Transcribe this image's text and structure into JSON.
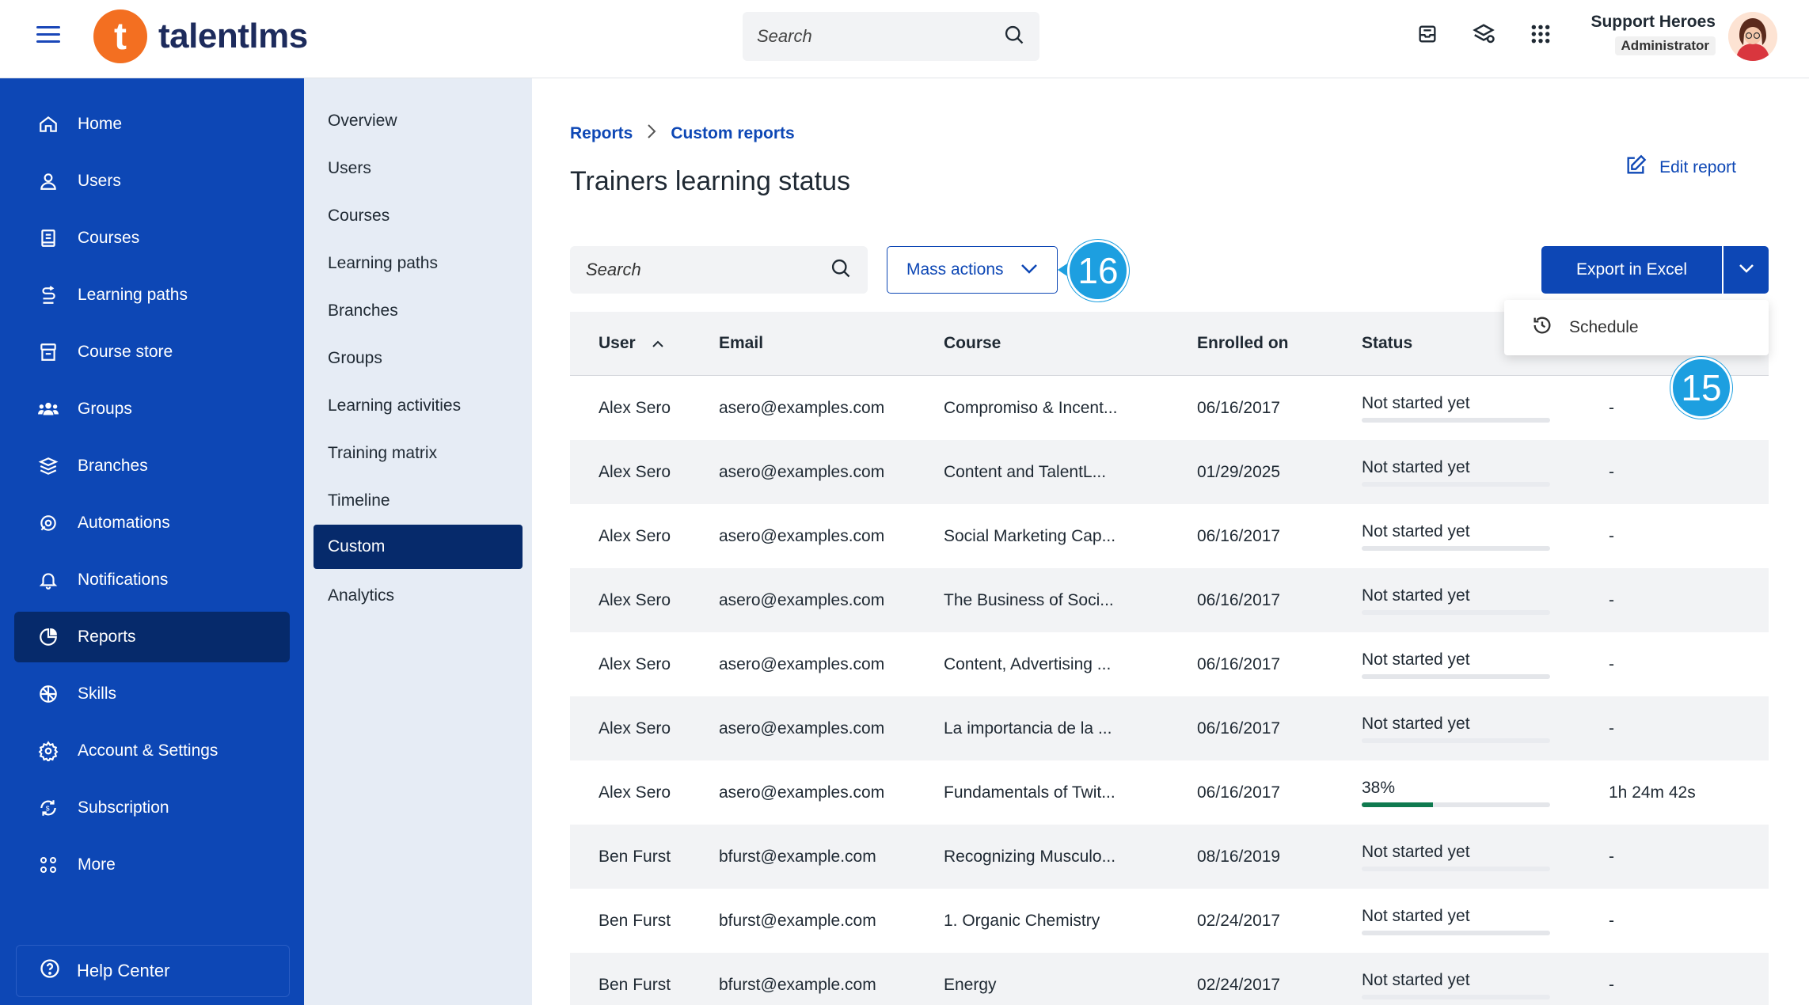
{
  "app": {
    "name": "talentlms",
    "logo_letter": "t",
    "brand_color": "#f36f21",
    "primary_color": "#0d47b5"
  },
  "topbar": {
    "search_placeholder": "Search",
    "icons": [
      "inbox-icon",
      "layers-sync-icon",
      "apps-grid-icon"
    ],
    "user_name": "Support Heroes",
    "user_role": "Administrator"
  },
  "sidebar": {
    "items": [
      {
        "label": "Home",
        "icon": "home-icon"
      },
      {
        "label": "Users",
        "icon": "user-icon"
      },
      {
        "label": "Courses",
        "icon": "course-icon"
      },
      {
        "label": "Learning paths",
        "icon": "path-icon"
      },
      {
        "label": "Course store",
        "icon": "store-icon"
      },
      {
        "label": "Groups",
        "icon": "groups-icon"
      },
      {
        "label": "Branches",
        "icon": "branches-icon"
      },
      {
        "label": "Automations",
        "icon": "automations-icon"
      },
      {
        "label": "Notifications",
        "icon": "bell-icon"
      },
      {
        "label": "Reports",
        "icon": "pie-chart-icon",
        "active": true
      },
      {
        "label": "Skills",
        "icon": "skills-icon"
      },
      {
        "label": "Account & Settings",
        "icon": "gear-icon"
      },
      {
        "label": "Subscription",
        "icon": "subscription-icon"
      },
      {
        "label": "More",
        "icon": "more-icon"
      }
    ],
    "help": "Help Center"
  },
  "subnav": {
    "items": [
      {
        "label": "Overview"
      },
      {
        "label": "Users"
      },
      {
        "label": "Courses"
      },
      {
        "label": "Learning paths"
      },
      {
        "label": "Branches"
      },
      {
        "label": "Groups"
      },
      {
        "label": "Learning activities"
      },
      {
        "label": "Training matrix"
      },
      {
        "label": "Timeline"
      },
      {
        "label": "Custom",
        "active": true
      },
      {
        "label": "Analytics"
      }
    ]
  },
  "main": {
    "breadcrumb": [
      "Reports",
      "Custom reports"
    ],
    "title": "Trainers learning status",
    "edit_report": "Edit report",
    "search_placeholder": "Search",
    "mass_actions": "Mass actions",
    "export_label": "Export in Excel",
    "dropdown_item": "Schedule",
    "callouts": [
      "16",
      "15"
    ]
  },
  "table": {
    "columns": [
      "User",
      "Email",
      "Course",
      "Enrolled on",
      "Status"
    ],
    "rows": [
      {
        "user": "Alex Sero",
        "email": "asero@examples.com",
        "course": "Compromiso & Incent...",
        "enrolled": "06/16/2017",
        "status": "Not started yet",
        "progress": 0,
        "time": "-"
      },
      {
        "user": "Alex Sero",
        "email": "asero@examples.com",
        "course": "Content and TalentL...",
        "enrolled": "01/29/2025",
        "status": "Not started yet",
        "progress": 0,
        "time": "-"
      },
      {
        "user": "Alex Sero",
        "email": "asero@examples.com",
        "course": "Social Marketing Cap...",
        "enrolled": "06/16/2017",
        "status": "Not started yet",
        "progress": 0,
        "time": "-"
      },
      {
        "user": "Alex Sero",
        "email": "asero@examples.com",
        "course": "The Business of Soci...",
        "enrolled": "06/16/2017",
        "status": "Not started yet",
        "progress": 0,
        "time": "-"
      },
      {
        "user": "Alex Sero",
        "email": "asero@examples.com",
        "course": "Content, Advertising ...",
        "enrolled": "06/16/2017",
        "status": "Not started yet",
        "progress": 0,
        "time": "-"
      },
      {
        "user": "Alex Sero",
        "email": "asero@examples.com",
        "course": "La importancia de la ...",
        "enrolled": "06/16/2017",
        "status": "Not started yet",
        "progress": 0,
        "time": "-"
      },
      {
        "user": "Alex Sero",
        "email": "asero@examples.com",
        "course": "Fundamentals of Twit...",
        "enrolled": "06/16/2017",
        "status": "38%",
        "progress": 38,
        "time": "1h 24m 42s"
      },
      {
        "user": "Ben Furst",
        "email": "bfurst@example.com",
        "course": "Recognizing Musculo...",
        "enrolled": "08/16/2019",
        "status": "Not started yet",
        "progress": 0,
        "time": "-"
      },
      {
        "user": "Ben Furst",
        "email": "bfurst@example.com",
        "course": "1. Organic Chemistry",
        "enrolled": "02/24/2017",
        "status": "Not started yet",
        "progress": 0,
        "time": "-"
      },
      {
        "user": "Ben Furst",
        "email": "bfurst@example.com",
        "course": "Energy",
        "enrolled": "02/24/2017",
        "status": "Not started yet",
        "progress": 0,
        "time": "-"
      }
    ]
  }
}
